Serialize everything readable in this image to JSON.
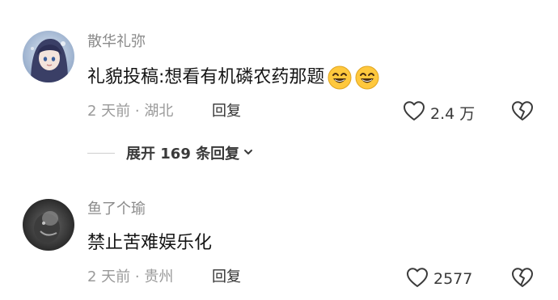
{
  "comments": [
    {
      "username": "散华礼弥",
      "content": "礼貌投稿:想看有机磷农药那题",
      "emojis": [
        "grinning-squint-emoji",
        "grinning-squint-emoji"
      ],
      "time": "2 天前",
      "separator": "·",
      "location": "湖北",
      "reply_label": "回复",
      "likes": "2.4 万",
      "expand_label": "展开 169 条回复"
    },
    {
      "username": "鱼了个瑜",
      "content": "禁止苦难娱乐化",
      "time": "2 天前",
      "separator": "·",
      "location": "贵州",
      "reply_label": "回复",
      "likes": "2577"
    }
  ],
  "icons": {
    "like": "heart-outline-icon",
    "dislike": "broken-heart-icon",
    "expand": "chevron-down-icon"
  },
  "colors": {
    "text_primary": "#151515",
    "text_secondary": "#8a8a8a",
    "emoji_fill": "#ffc83d"
  }
}
